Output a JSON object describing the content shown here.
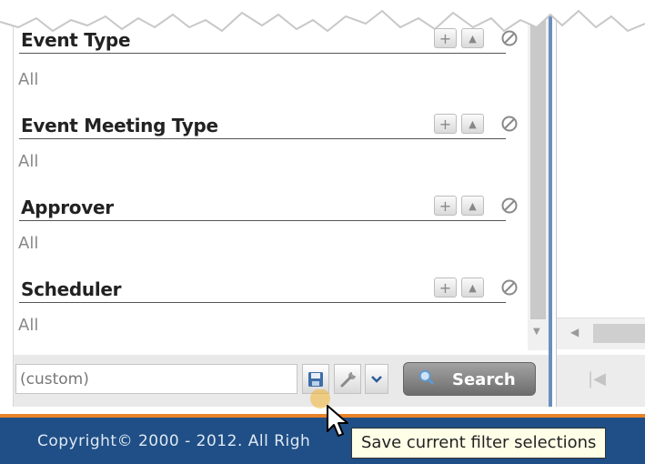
{
  "filters": [
    {
      "title": "Event Type",
      "value": "All"
    },
    {
      "title": "Event Meeting Type",
      "value": "All"
    },
    {
      "title": "Approver",
      "value": "All"
    },
    {
      "title": "Scheduler",
      "value": "All"
    }
  ],
  "bottom": {
    "custom_value": "(custom)",
    "search_label": "Search"
  },
  "footer": {
    "copyright": "Copyright© 2000 - 2012.  All Righ"
  },
  "tooltip": "Save current filter selections",
  "icons": {
    "add": "plus-icon",
    "collapse": "triangle-up-icon",
    "clear": "no-symbol-icon",
    "save": "save-icon",
    "wrench": "wrench-icon",
    "dropdown": "chevron-down-icon",
    "search": "magnifier-icon",
    "first_page": "first-page-icon"
  },
  "colors": {
    "footer": "#1f4f86",
    "accent_line": "#e8832a",
    "tooltip_bg": "#ffffe8"
  }
}
